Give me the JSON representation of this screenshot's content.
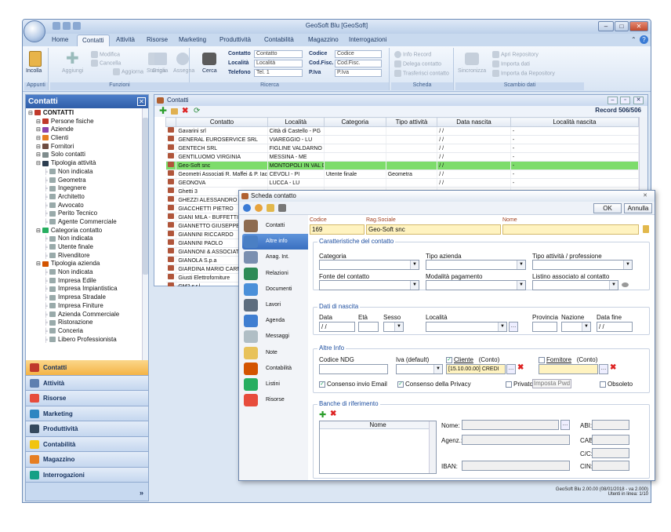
{
  "window": {
    "title": "GeoSoft Blu [GeoSoft]"
  },
  "tabs": [
    "Home",
    "Contatti",
    "Attività",
    "Risorse",
    "Marketing",
    "Produttività",
    "Contabilità",
    "Magazzino",
    "Interrogazioni"
  ],
  "active_tab": "Contatti",
  "ribbon": {
    "appunti": {
      "label": "Appunti",
      "incolla": "Incolla"
    },
    "funzioni": {
      "label": "Funzioni",
      "aggiungi": "Aggiungi",
      "modifica": "Modifica",
      "cancella": "Cancella",
      "aggiorna": "Aggiorna",
      "stampa": "Stampa",
      "griglia": "Griglia",
      "assegna": "Assegna"
    },
    "ricerca": {
      "label": "Ricerca",
      "cerca": "Cerca",
      "contatto_label": "Contatto",
      "contatto_ph": "Contatto",
      "localita_label": "Località",
      "localita_ph": "Località",
      "telefono_label": "Telefono",
      "telefono_ph": "Tel. 1",
      "codice_label": "Codice",
      "codice_ph": "Codice",
      "codfisc_label": "Cod.Fisc.",
      "codfisc_ph": "Cod.Fisc.",
      "piva_label": "P.Iva",
      "piva_ph": "P.Iva"
    },
    "scheda": {
      "label": "Scheda",
      "info_record": "Info Record",
      "delega": "Delega contatto",
      "trasferisci": "Trasferisci contatto"
    },
    "scambio": {
      "label": "Scambio dati",
      "sincronizza": "Sincronizza",
      "apri_repo": "Apri Repository",
      "importa": "Importa dati",
      "importa_repo": "Importa da Repository"
    }
  },
  "left_panel": {
    "title": "Contatti",
    "tree": [
      {
        "label": "CONTATTI",
        "level": 0,
        "color": "#c0392b"
      },
      {
        "label": "Persone fisiche",
        "level": 1,
        "color": "#c0392b"
      },
      {
        "label": "Aziende",
        "level": 1,
        "color": "#8e44ad"
      },
      {
        "label": "Clienti",
        "level": 1,
        "color": "#e67e22"
      },
      {
        "label": "Fornitori",
        "level": 1,
        "color": "#6d4c41"
      },
      {
        "label": "Solo contatti",
        "level": 1,
        "color": "#7f8c8d"
      },
      {
        "label": "Tipologia attività",
        "level": 1,
        "color": "#2c3e50"
      },
      {
        "label": "Non indicata",
        "level": 2,
        "color": "#9aa"
      },
      {
        "label": "Geometra",
        "level": 2,
        "color": "#9aa"
      },
      {
        "label": "Ingegnere",
        "level": 2,
        "color": "#9aa"
      },
      {
        "label": "Architetto",
        "level": 2,
        "color": "#9aa"
      },
      {
        "label": "Avvocato",
        "level": 2,
        "color": "#9aa"
      },
      {
        "label": "Perito Tecnico",
        "level": 2,
        "color": "#9aa"
      },
      {
        "label": "Agente Commerciale",
        "level": 2,
        "color": "#9aa"
      },
      {
        "label": "Categoria contatto",
        "level": 1,
        "color": "#27ae60"
      },
      {
        "label": "Non indicata",
        "level": 2,
        "color": "#9aa"
      },
      {
        "label": "Utente finale",
        "level": 2,
        "color": "#9aa"
      },
      {
        "label": "Rivenditore",
        "level": 2,
        "color": "#9aa"
      },
      {
        "label": "Tipologia azienda",
        "level": 1,
        "color": "#d35400"
      },
      {
        "label": "Non indicata",
        "level": 2,
        "color": "#9aa"
      },
      {
        "label": "Impresa Edile",
        "level": 2,
        "color": "#9aa"
      },
      {
        "label": "Impresa Impiantistica",
        "level": 2,
        "color": "#9aa"
      },
      {
        "label": "Impresa Stradale",
        "level": 2,
        "color": "#9aa"
      },
      {
        "label": "Impresa Finiture",
        "level": 2,
        "color": "#9aa"
      },
      {
        "label": "Azienda Commerciale",
        "level": 2,
        "color": "#9aa"
      },
      {
        "label": "Ristorazione",
        "level": 2,
        "color": "#9aa"
      },
      {
        "label": "Conceria",
        "level": 2,
        "color": "#9aa"
      },
      {
        "label": "Libero Professionista",
        "level": 2,
        "color": "#9aa"
      }
    ],
    "nav": [
      {
        "label": "Contatti",
        "color": "#c0392b"
      },
      {
        "label": "Attività",
        "color": "#5d7fb0"
      },
      {
        "label": "Risorse",
        "color": "#e74c3c"
      },
      {
        "label": "Marketing",
        "color": "#2e86c1"
      },
      {
        "label": "Produttività",
        "color": "#34495e"
      },
      {
        "label": "Contabilità",
        "color": "#f1c40f"
      },
      {
        "label": "Magazzino",
        "color": "#e67e22"
      },
      {
        "label": "Interrogazioni",
        "color": "#16a085"
      }
    ],
    "more": "»"
  },
  "grid": {
    "title": "Contatti",
    "record": "Record 506/506",
    "columns": [
      "Contatto",
      "Località",
      "Categoria",
      "Tipo attività",
      "Data nascita",
      "Località nascita"
    ],
    "rows": [
      [
        "Gavarini srl",
        "Città di Castello - PG",
        "",
        "",
        "/ /",
        "-"
      ],
      [
        "GENERAL EUROSERVICE SRL",
        "VIAREGGIO - LU",
        "",
        "",
        "/ /",
        "-"
      ],
      [
        "GENTECH SRL",
        "FIGLINE VALDARNO - FI",
        "",
        "",
        "/ /",
        "-"
      ],
      [
        "GENTILUOMO VIRGINIA",
        "MESSINA - ME",
        "",
        "",
        "/ /",
        "-"
      ],
      [
        "Geo-Soft snc",
        "MONTOPOLI IN VAL D'ARNO",
        "",
        "",
        "/ /",
        "-"
      ],
      [
        "Geometri Associati R. Maffei & P. Iacoponi",
        "CEVOLI - PI",
        "Utente finale",
        "Geometra",
        "/ /",
        "-"
      ],
      [
        "GEONOVA",
        "LUCCA - LU",
        "",
        "",
        "/ /",
        "-"
      ],
      [
        "Ghetti 3",
        "",
        "",
        "",
        "",
        ""
      ],
      [
        "GHEZZI ALESSANDRO",
        "",
        "",
        "",
        "",
        ""
      ],
      [
        "GIACCHETTI PIETRO",
        "",
        "",
        "",
        "",
        ""
      ],
      [
        "GIANI MILA - BUFFETTI",
        "",
        "",
        "",
        "",
        ""
      ],
      [
        "GIANNETTO GIUSEPPE",
        "",
        "",
        "",
        "",
        ""
      ],
      [
        "GIANNINI RICCARDO",
        "",
        "",
        "",
        "",
        ""
      ],
      [
        "GIANNINI PAOLO",
        "",
        "",
        "",
        "",
        ""
      ],
      [
        "GIANNONI & ASSOCIATI Stud",
        "",
        "",
        "",
        "",
        ""
      ],
      [
        "GIANOLA S.p.a",
        "",
        "",
        "",
        "",
        ""
      ],
      [
        "GIARDINA MARIO CARMELO",
        "",
        "",
        "",
        "",
        ""
      ],
      [
        "Giusti Elettroforniture",
        "",
        "",
        "",
        "",
        ""
      ],
      [
        "GM2 s.r.l.",
        "",
        "",
        "",
        "",
        ""
      ],
      [
        "Goffredo Domenico",
        "",
        "",
        "",
        "",
        ""
      ],
      [
        "GRAFILL s.r.l.",
        "",
        "",
        "",
        "",
        ""
      ],
      [
        "GRAZINI ANDREA",
        "",
        "",
        "",
        "",
        ""
      ],
      [
        "Grazzini Cav. Fortunato S.p.a",
        "",
        "",
        "",
        "",
        ""
      ],
      [
        "GREEN GRASS srl",
        "",
        "",
        "",
        "",
        ""
      ],
      [
        "GRUPPO MOLISANO sas di T",
        "",
        "",
        "",
        "",
        ""
      ],
      [
        "GUARINO PAOLO",
        "",
        "",
        "",
        "",
        ""
      ],
      [
        "GUASTI srl",
        "",
        "",
        "",
        "",
        ""
      ]
    ],
    "selected_row": 4
  },
  "dialog": {
    "title": "Scheda contatto",
    "ok": "OK",
    "annulla": "Annulla",
    "side": [
      "Contatti",
      "Altre info",
      "Anag. Int.",
      "Relazioni",
      "Documenti",
      "Lavori",
      "Agenda",
      "Messaggi",
      "Note",
      "Contabilità",
      "Listini",
      "Risorse"
    ],
    "side_colors": [
      "#8e6b4f",
      "#4a7fc4",
      "#7a8fb0",
      "#2e8b57",
      "#4a90d9",
      "#5d6d7e",
      "#3f7ed1",
      "#b0bec5",
      "#e8c25a",
      "#d35400",
      "#27ae60",
      "#e74c3c"
    ],
    "codice_label": "Codice",
    "codice": "169",
    "ragsoc_label": "Rag.Sociale",
    "ragsoc": "Geo-Soft snc",
    "nome_label": "Nome",
    "nome": "",
    "caratteristiche": "Caratteristiche del contatto",
    "categoria": "Categoria",
    "tipo_azienda": "Tipo azienda",
    "tipo_attivita": "Tipo attività / professione",
    "fonte": "Fonte del contatto",
    "modalita": "Modalità pagamento",
    "listino": "Listino associato al contatto",
    "nascita": "Dati di nascita",
    "data": "Data",
    "eta": "Età",
    "sesso": "Sesso",
    "localita": "Località",
    "provincia": "Provincia",
    "nazione": "Nazione",
    "data_fine": "Data fine",
    "data_val": "/ /",
    "data_fine_val": "/ /",
    "altre": "Altre Info",
    "codice_ndg": "Codice NDG",
    "iva": "Iva (default)",
    "cliente_lbl": "Cliente",
    "conto1": "(Conto)",
    "cliente_val": "[15.10.00.00] CREDI",
    "fornitore_lbl": "Fornitore",
    "conto2": "(Conto)",
    "consenso_email": "Consenso invio Email",
    "consenso_privacy": "Consenso della Privacy",
    "privato": "Privato",
    "imposta_pwd": "Imposta Pwd",
    "obsoleto": "Obsoleto",
    "banche": "Banche di riferimento",
    "banche_col": "Nome",
    "nome_b": "Nome:",
    "agenz": "Agenz.:",
    "iban": "IBAN:",
    "abi": "ABI:",
    "cab": "CAB:",
    "cic": "C/C:",
    "cin": "CIN:"
  },
  "status": {
    "line1": "GeoSoft Blu 2.00.00 (08/01/2018 - va 2.000)",
    "line2": "Utenti in linea: 1/10"
  }
}
